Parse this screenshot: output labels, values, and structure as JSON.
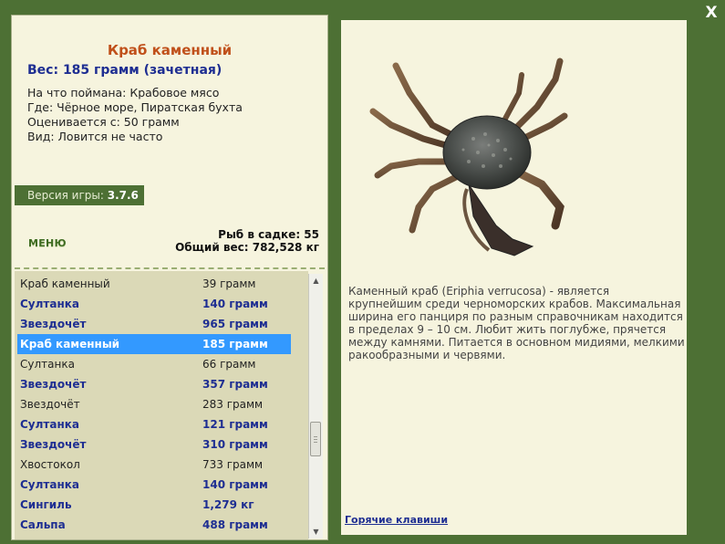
{
  "close_label": "X",
  "fish": {
    "title": "Краб каменный",
    "weight": "Вес: 185 грамм (зачетная)",
    "info": [
      "На что поймана: Крабовое мясо",
      "Где: Чёрное море, Пиратская бухта",
      "Оценивается с: 50 грамм",
      "Вид: Ловится не часто"
    ]
  },
  "version": {
    "label": "Версия игры:",
    "value": "3.7.6"
  },
  "menu_label": "МЕНЮ",
  "stats": {
    "count": "Рыб в садке: 55",
    "total": "Общий вес: 782,528 кг"
  },
  "catch_list": [
    {
      "name": "Краб каменный",
      "weight": "39 грамм",
      "style": "plain"
    },
    {
      "name": "Султанка",
      "weight": "140 грамм",
      "style": "bold"
    },
    {
      "name": "Звездочёт",
      "weight": "965 грамм",
      "style": "bold"
    },
    {
      "name": "Краб каменный",
      "weight": "185 грамм",
      "style": "selected"
    },
    {
      "name": "Султанка",
      "weight": "66 грамм",
      "style": "plain"
    },
    {
      "name": "Звездочёт",
      "weight": "357 грамм",
      "style": "bold"
    },
    {
      "name": "Звездочёт",
      "weight": "283 грамм",
      "style": "plain"
    },
    {
      "name": "Султанка",
      "weight": "121 грамм",
      "style": "bold"
    },
    {
      "name": "Звездочёт",
      "weight": "310 грамм",
      "style": "bold"
    },
    {
      "name": "Хвостокол",
      "weight": "733 грамм",
      "style": "plain"
    },
    {
      "name": "Султанка",
      "weight": "140 грамм",
      "style": "bold"
    },
    {
      "name": "Сингиль",
      "weight": "1,279 кг",
      "style": "bold"
    },
    {
      "name": "Сальпа",
      "weight": "488 грамм",
      "style": "bold"
    }
  ],
  "description": "Каменный краб (Eriphia verrucosa) - является крупнейшим среди черноморских крабов. Максимальная ширина его панциря по разным справочникам находится в пределах 9 – 10 см. Любит жить поглубже, прячется между камнями. Питается в основном мидиями, мелкими ракообразными и червями.",
  "hotkeys_label": "Горячие клавиши",
  "colors": {
    "frame_green": "#4d7034",
    "panel_bg": "#f6f4de",
    "title_orange": "#c0501a",
    "bold_blue": "#1e2e92",
    "selected_blue": "#3399ff"
  },
  "icons": [
    "close-icon",
    "scroll-up-icon",
    "scroll-down-icon",
    "crab-image"
  ]
}
